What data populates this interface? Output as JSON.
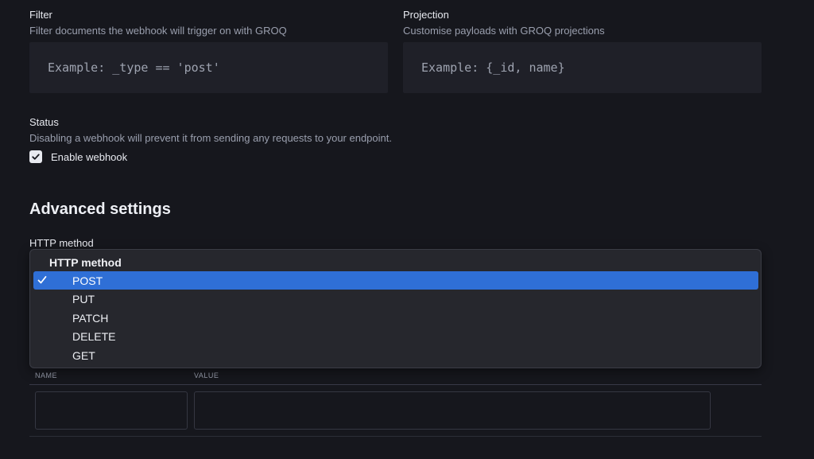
{
  "filter": {
    "label": "Filter",
    "description": "Filter documents the webhook will trigger on with GROQ",
    "placeholder": "Example: _type == 'post'"
  },
  "projection": {
    "label": "Projection",
    "description": "Customise payloads with GROQ projections",
    "placeholder": "Example: {_id, name}"
  },
  "status": {
    "label": "Status",
    "description": "Disabling a webhook will prevent it from sending any requests to your endpoint.",
    "checkbox_label": "Enable webhook",
    "checked": true
  },
  "advanced": {
    "title": "Advanced settings",
    "http_method_label": "HTTP method"
  },
  "dropdown": {
    "header": "HTTP method",
    "options": [
      "POST",
      "PUT",
      "PATCH",
      "DELETE",
      "GET"
    ],
    "selected": "POST"
  },
  "headers_table": {
    "columns": [
      "NAME",
      "VALUE"
    ],
    "rows": [
      {
        "name": "",
        "value": ""
      }
    ]
  },
  "colors": {
    "accent": "#2f6fd6",
    "background": "#16171d"
  }
}
